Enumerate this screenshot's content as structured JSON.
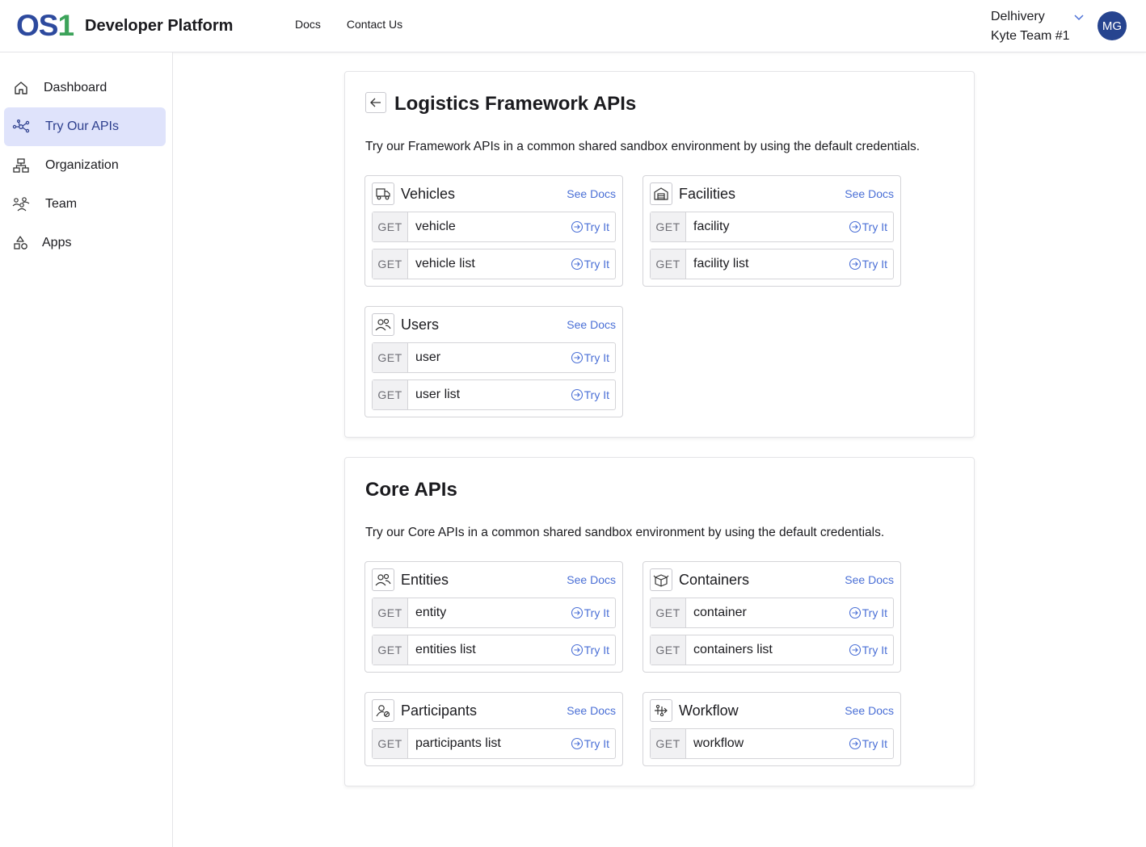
{
  "header": {
    "logo_os": "OS",
    "logo_one": "1",
    "title": "Developer Platform",
    "nav": [
      "Docs",
      "Contact Us"
    ],
    "tenant_org": "Delhivery",
    "tenant_team": "Kyte Team #1",
    "avatar_initials": "MG"
  },
  "sidebar": {
    "items": [
      {
        "label": "Dashboard",
        "icon": "home-icon",
        "active": false
      },
      {
        "label": "Try Our APIs",
        "icon": "network-icon",
        "active": true
      },
      {
        "label": "Organization",
        "icon": "org-chart-icon",
        "active": false
      },
      {
        "label": "Team",
        "icon": "team-icon",
        "active": false
      },
      {
        "label": "Apps",
        "icon": "shapes-icon",
        "active": false
      }
    ]
  },
  "logistics": {
    "title": "Logistics Framework APIs",
    "description": "Try our Framework APIs in a common shared sandbox environment by using the default credentials.",
    "cards": [
      {
        "title": "Vehicles",
        "icon": "truck-icon",
        "see_docs": "See Docs",
        "rows": [
          {
            "method": "GET",
            "name": "vehicle",
            "try": "Try It"
          },
          {
            "method": "GET",
            "name": "vehicle list",
            "try": "Try It"
          }
        ]
      },
      {
        "title": "Facilities",
        "icon": "warehouse-icon",
        "see_docs": "See Docs",
        "rows": [
          {
            "method": "GET",
            "name": "facility",
            "try": "Try It"
          },
          {
            "method": "GET",
            "name": "facility list",
            "try": "Try It"
          }
        ]
      },
      {
        "title": "Users",
        "icon": "users-icon",
        "see_docs": "See Docs",
        "rows": [
          {
            "method": "GET",
            "name": "user",
            "try": "Try It"
          },
          {
            "method": "GET",
            "name": "user list",
            "try": "Try It"
          }
        ]
      }
    ]
  },
  "core": {
    "title": "Core APIs",
    "description": "Try our Core APIs in a common shared sandbox environment by using the default credentials.",
    "cards": [
      {
        "title": "Entities",
        "icon": "users-icon",
        "see_docs": "See Docs",
        "rows": [
          {
            "method": "GET",
            "name": "entity",
            "try": "Try It"
          },
          {
            "method": "GET",
            "name": "entities list",
            "try": "Try It"
          }
        ]
      },
      {
        "title": "Containers",
        "icon": "box-icon",
        "see_docs": "See Docs",
        "rows": [
          {
            "method": "GET",
            "name": "container",
            "try": "Try It"
          },
          {
            "method": "GET",
            "name": "containers list",
            "try": "Try It"
          }
        ]
      },
      {
        "title": "Participants",
        "icon": "participant-icon",
        "see_docs": "See Docs",
        "rows": [
          {
            "method": "GET",
            "name": "participants list",
            "try": "Try It"
          }
        ]
      },
      {
        "title": "Workflow",
        "icon": "workflow-icon",
        "see_docs": "See Docs",
        "rows": [
          {
            "method": "GET",
            "name": "workflow",
            "try": "Try It"
          }
        ]
      }
    ]
  },
  "colors": {
    "brand_blue": "#2d4a9e",
    "brand_green": "#3ca35a",
    "link_blue": "#4a6fd6",
    "active_bg": "#dfe3fb",
    "avatar_bg": "#26448f"
  }
}
